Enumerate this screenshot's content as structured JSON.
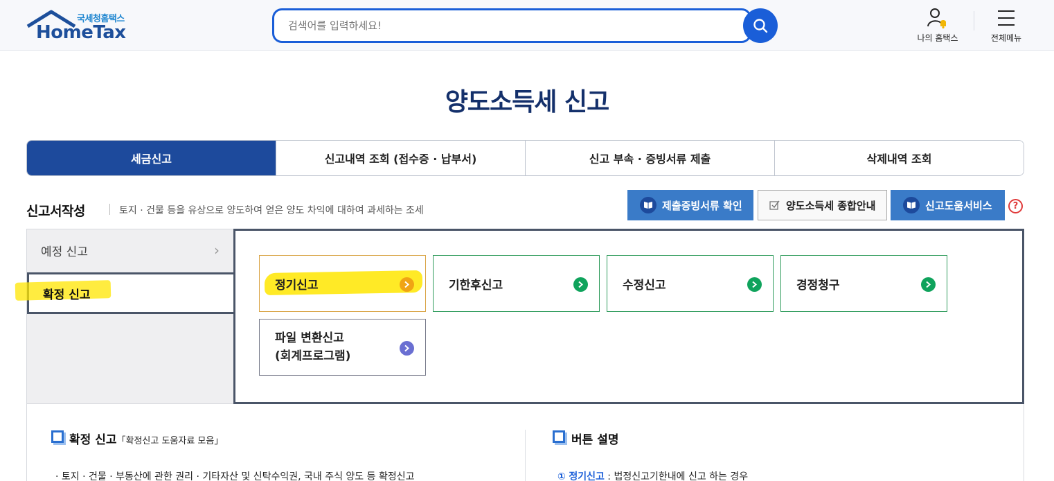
{
  "header": {
    "logo_sub": "국세청홈택스",
    "logo_main": "HomeTax",
    "search_placeholder": "검색어를 입력하세요!",
    "my_hometax": "나의 홈택스",
    "all_menu": "전체메뉴"
  },
  "page_title": "양도소득세 신고",
  "tabs": [
    {
      "label": "세금신고",
      "active": true
    },
    {
      "label": "신고내역 조회 (접수증 · 납부서)",
      "active": false
    },
    {
      "label": "신고 부속 · 증빙서류 제출",
      "active": false
    },
    {
      "label": "삭제내역 조회",
      "active": false
    }
  ],
  "section": {
    "title": "신고서작성",
    "desc": "토지 · 건물 등을 유상으로 양도하여 얻은 양도 차익에 대하여 과세하는 조세"
  },
  "actions": {
    "proof_check": "제출증빙서류 확인",
    "guide": "양도소득세 종합안내",
    "help_service": "신고도움서비스",
    "help_icon": "?"
  },
  "side_menu": [
    {
      "label": "예정 신고",
      "selected": false
    },
    {
      "label": "확정 신고",
      "selected": true
    }
  ],
  "cards": [
    {
      "label": "정기신고"
    },
    {
      "label": "기한후신고"
    },
    {
      "label": "수정신고"
    },
    {
      "label": "경정청구"
    },
    {
      "label_line1": "파일 변환신고",
      "label_line2": "(회계프로그램)"
    }
  ],
  "bottom": {
    "left_title": "확정 신고",
    "left_sub": "「확정신고 도움자료 모음」",
    "left_text": "· 토지 · 건물 · 부동산에 관한 권리 · 기타자산 및 신탁수익권, 국내 주식 양도 등 확정신고",
    "right_title": "버튼 설명",
    "right_num": "①",
    "right_link": "정기신고",
    "right_text": " : 법정신고기한내에 신고 하는 경우"
  },
  "colors": {
    "brand_navy": "#1d4a9c",
    "search_blue": "#1a5ed8",
    "action_blue": "#3a7bc8",
    "go_green": "#0fa35c",
    "highlight_yellow": "#ffe600"
  }
}
